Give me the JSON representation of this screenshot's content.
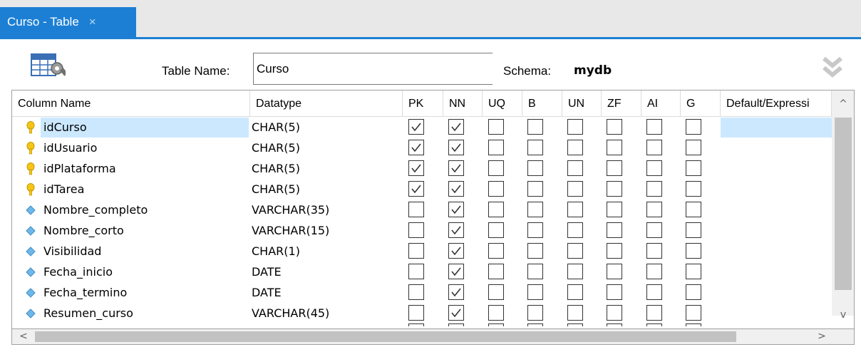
{
  "tab": {
    "label": "Curso - Table",
    "close": "×"
  },
  "header": {
    "table_name_label": "Table Name:",
    "table_name_value": "Curso",
    "schema_label": "Schema:",
    "schema_value": "mydb"
  },
  "columns_header": [
    "Column Name",
    "Datatype",
    "PK",
    "NN",
    "UQ",
    "B",
    "UN",
    "ZF",
    "AI",
    "G",
    "Default/Expressi"
  ],
  "rows": [
    {
      "name": "idCurso",
      "type": "CHAR(5)",
      "icon": "key-icon",
      "flags": [
        1,
        1,
        0,
        0,
        0,
        0,
        0,
        0
      ],
      "selected": true
    },
    {
      "name": "idUsuario",
      "type": "CHAR(5)",
      "icon": "key-icon",
      "flags": [
        1,
        1,
        0,
        0,
        0,
        0,
        0,
        0
      ]
    },
    {
      "name": "idPlataforma",
      "type": "CHAR(5)",
      "icon": "key-icon",
      "flags": [
        1,
        1,
        0,
        0,
        0,
        0,
        0,
        0
      ]
    },
    {
      "name": "idTarea",
      "type": "CHAR(5)",
      "icon": "key-icon",
      "flags": [
        1,
        1,
        0,
        0,
        0,
        0,
        0,
        0
      ]
    },
    {
      "name": "Nombre_completo",
      "type": "VARCHAR(35)",
      "icon": "column-diamond-icon",
      "flags": [
        0,
        1,
        0,
        0,
        0,
        0,
        0,
        0
      ]
    },
    {
      "name": "Nombre_corto",
      "type": "VARCHAR(15)",
      "icon": "column-diamond-icon",
      "flags": [
        0,
        1,
        0,
        0,
        0,
        0,
        0,
        0
      ]
    },
    {
      "name": "Visibilidad",
      "type": "CHAR(1)",
      "icon": "column-diamond-icon",
      "flags": [
        0,
        1,
        0,
        0,
        0,
        0,
        0,
        0
      ]
    },
    {
      "name": "Fecha_inicio",
      "type": "DATE",
      "icon": "column-diamond-icon",
      "flags": [
        0,
        1,
        0,
        0,
        0,
        0,
        0,
        0
      ]
    },
    {
      "name": "Fecha_termino",
      "type": "DATE",
      "icon": "column-diamond-icon",
      "flags": [
        0,
        1,
        0,
        0,
        0,
        0,
        0,
        0
      ]
    },
    {
      "name": "Resumen_curso",
      "type": "VARCHAR(45)",
      "icon": "column-diamond-icon",
      "flags": [
        0,
        1,
        0,
        0,
        0,
        0,
        0,
        0
      ]
    }
  ],
  "scrollbar": {
    "up": "^",
    "down": "v",
    "left": "<",
    "right": ">"
  },
  "colors": {
    "accent": "#1c7fd4",
    "selection": "#cce8ff",
    "key": "#f5c518",
    "diamond": "#6fb7e8"
  }
}
